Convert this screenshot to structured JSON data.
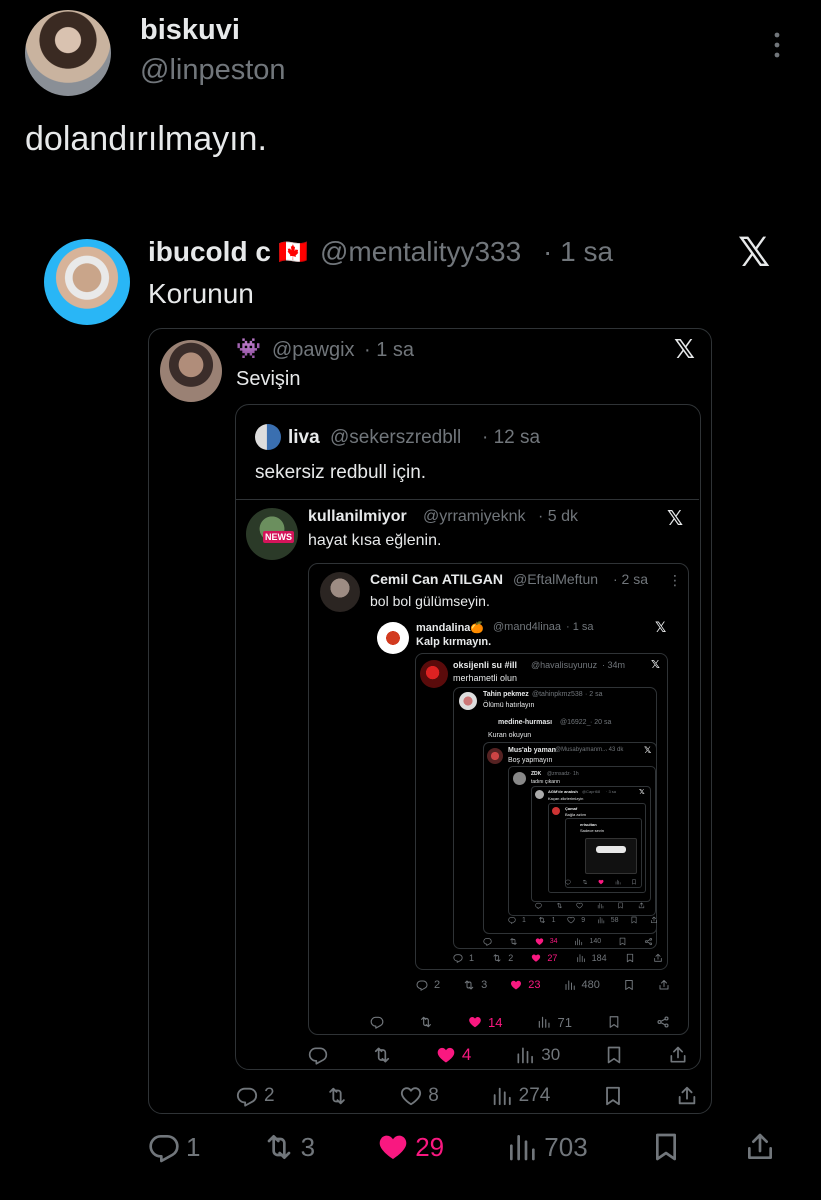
{
  "main": {
    "name": "biskuvi",
    "handle": "@linpeston",
    "text": "dolandırılmayın.",
    "stats": {
      "replies": "1",
      "reposts": "3",
      "likes": "29",
      "views": "703"
    }
  },
  "q1": {
    "name": "ibucold c",
    "flag": "🇨🇦",
    "handle": "@mentalityy333",
    "time": "· 1 sa",
    "text": "Korunun",
    "stats": {
      "replies": "2",
      "reposts": "",
      "likes": "8",
      "views": "274"
    }
  },
  "q2": {
    "emoji": "👾",
    "handle": "@pawgix",
    "time": "· 1 sa",
    "text": "Sevişin",
    "stats": {
      "replies": "",
      "reposts": "",
      "likes": "4",
      "views": "30"
    }
  },
  "q3": {
    "name": "liva",
    "handle": "@sekerszredbll",
    "time": "· 12 sa",
    "text": "sekersiz redbull için."
  },
  "q4": {
    "name": "kullanilmiyor",
    "handle": "@yrramiyeknk",
    "time": "· 5 dk",
    "text": "hayat kısa eğlenin.",
    "avatar_badge": "NEWS"
  },
  "q5": {
    "name": "Cemil Can ATILGAN",
    "handle": "@EftalMeftun",
    "time": "· 2 sa",
    "text": "bol bol gülümseyin.",
    "stats": {
      "replies": "",
      "reposts": "",
      "likes": "14",
      "views": "71"
    }
  },
  "q6": {
    "name": "mandalina🍊",
    "handle": "@mand4linaa",
    "time": "· 1 sa",
    "text": "Kalp kırmayın.",
    "stats": {
      "replies": "2",
      "reposts": "3",
      "likes": "23",
      "views": "480"
    }
  },
  "q7": {
    "name": "oksijenli su #ill",
    "handle": "@havalisuyunuz",
    "time": "· 34m",
    "text": "merhametli olun",
    "stats": {
      "replies": "1",
      "reposts": "2",
      "likes": "27",
      "views": "184"
    }
  },
  "q8": {
    "name": "Tahin pekmez",
    "handle": "@tahinpkmz538",
    "time": "· 2 sa",
    "text": "Ölümü hatırlayın",
    "stats": {
      "replies": "",
      "reposts": "",
      "likes": "34",
      "views": "140"
    }
  },
  "q9": {
    "name": "medine-hurması",
    "handle": "@16922_",
    "time": "· 20 sa",
    "text": "Kuran okuyun"
  },
  "q10": {
    "name": "Mus'ab yaman",
    "handle": "@Musabyamanm...",
    "time": "· 43 dk",
    "text": "Boş yapmayın",
    "stats": {
      "replies": "1",
      "reposts": "1",
      "likes": "9",
      "views": "58"
    }
  },
  "q11": {
    "name": "ZDK",
    "handle": "@zrnsadz",
    "time": "· 1h",
    "text": "tadını çıkarın"
  },
  "q12": {
    "name": "AGM'de anaksh",
    "handle": "@Capri68",
    "time": "· 3 sa",
    "text": "Kaçan zikrlerimizyin"
  },
  "q13": {
    "name": "Çamaf",
    "handle": "",
    "time": "",
    "text": "Bağla azlım"
  },
  "q14": {
    "name": "erisultan",
    "handle": "",
    "time": "",
    "text": "Sadece sevin"
  },
  "colors": {
    "bg": "#000000",
    "text": "#e7e9ea",
    "muted": "#71767b",
    "border": "#2f3336",
    "like": "#f91880"
  }
}
